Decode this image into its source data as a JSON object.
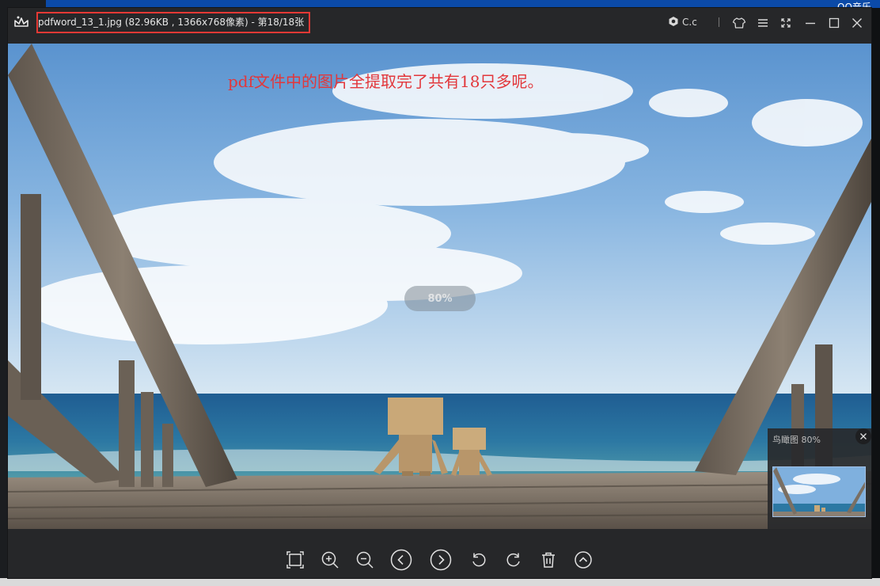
{
  "window": {
    "title": "pdfword_13_1.jpg (82.96KB , 1366x768像素) - 第18/18张"
  },
  "titlebar": {
    "cc_label": "C.c",
    "icons": [
      "app-logo-icon",
      "account-badge-icon",
      "skin-shirt-icon",
      "menu-icon",
      "fullscreen-icon",
      "minimize-icon",
      "maximize-icon",
      "close-icon"
    ]
  },
  "image": {
    "caption": "pdf文件中的图片全提取完了共有18只多呢。",
    "zoom_label": "80%"
  },
  "navigator": {
    "title": "鸟瞰图 80%"
  },
  "toolbar": {
    "icons": [
      "fit-window-icon",
      "zoom-in-icon",
      "zoom-out-icon",
      "previous-icon",
      "next-icon",
      "rotate-left-icon",
      "rotate-right-icon",
      "delete-icon",
      "more-up-icon"
    ]
  },
  "desktop": {
    "edge_text": "OO音乐"
  },
  "colors": {
    "window_bg": "#262729",
    "highlight": "#e53935",
    "caption": "#e2373b",
    "desktop_blue": "#0b4aa8"
  }
}
